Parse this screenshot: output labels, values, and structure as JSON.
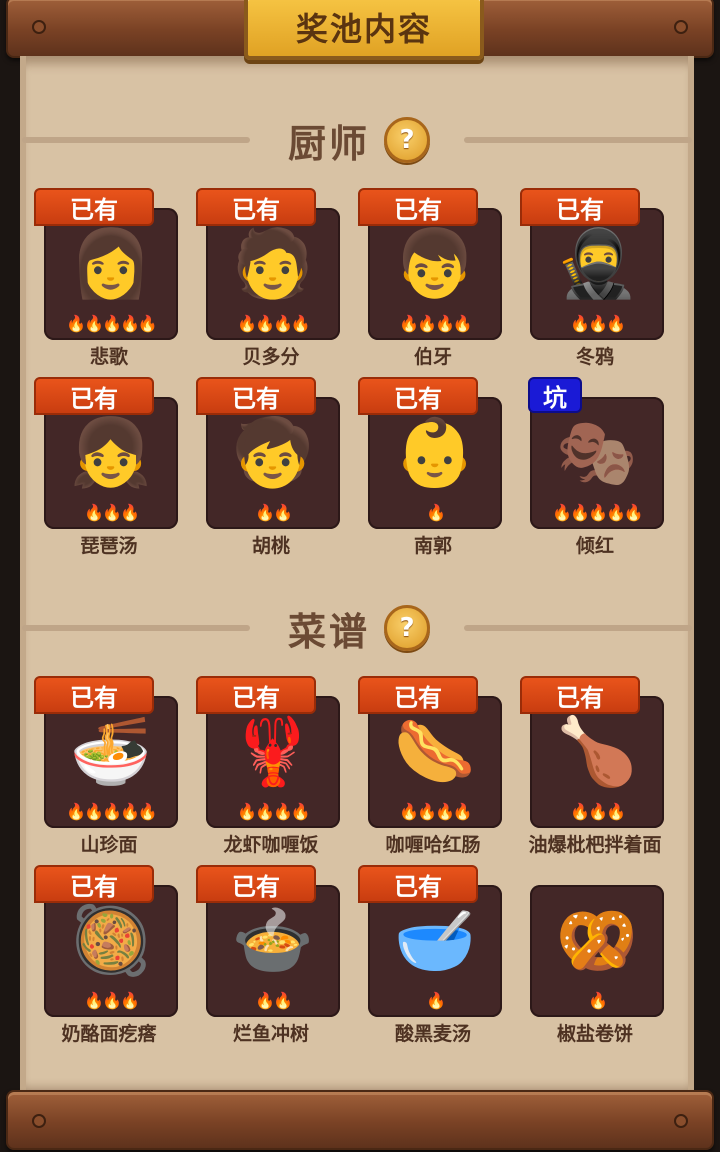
{
  "header": {
    "title": "奖池内容"
  },
  "sections": [
    {
      "title": "厨师",
      "help": "?"
    },
    {
      "title": "菜谱",
      "help": "?"
    }
  ],
  "chefs": [
    {
      "name": "悲歌",
      "badge": "已有",
      "art": "👩",
      "flames": "🔥🔥🔥🔥🔥"
    },
    {
      "name": "贝多分",
      "badge": "已有",
      "art": "🧑",
      "flames": "🔥🔥🔥🔥"
    },
    {
      "name": "伯牙",
      "badge": "已有",
      "art": "👦",
      "flames": "🔥🔥🔥🔥"
    },
    {
      "name": "冬鸦",
      "badge": "已有",
      "art": "🥷",
      "flames": "🔥🔥🔥"
    },
    {
      "name": "琵琶汤",
      "badge": "已有",
      "art": "👧",
      "flames": "🔥🔥🔥"
    },
    {
      "name": "胡桃",
      "badge": "已有",
      "art": "🧒",
      "flames": "🔥🔥"
    },
    {
      "name": "南郭",
      "badge": "已有",
      "art": "👶",
      "flames": "🔥"
    },
    {
      "name": "倾红",
      "badge": "坑",
      "art": "🎭",
      "flames": "🔥🔥🔥🔥🔥"
    }
  ],
  "recipes": [
    {
      "name": "山珍面",
      "badge": "已有",
      "art": "🍜",
      "flames": "🔥🔥🔥🔥🔥"
    },
    {
      "name": "龙虾咖喱饭",
      "badge": "已有",
      "art": "🦞",
      "flames": "🔥🔥🔥🔥"
    },
    {
      "name": "咖喱哈红肠",
      "badge": "已有",
      "art": "🌭",
      "flames": "🔥🔥🔥🔥"
    },
    {
      "name": "油爆枇杷拌着面",
      "badge": "已有",
      "art": "🍗",
      "flames": "🔥🔥🔥"
    },
    {
      "name": "奶酪面疙瘩",
      "badge": "已有",
      "art": "🥘",
      "flames": "🔥🔥🔥"
    },
    {
      "name": "烂鱼冲树",
      "badge": "已有",
      "art": "🍲",
      "flames": "🔥🔥"
    },
    {
      "name": "酸黑麦汤",
      "badge": "已有",
      "art": "🥣",
      "flames": "🔥"
    },
    {
      "name": "椒盐卷饼",
      "badge": "",
      "art": "🥨",
      "flames": "🔥"
    }
  ]
}
